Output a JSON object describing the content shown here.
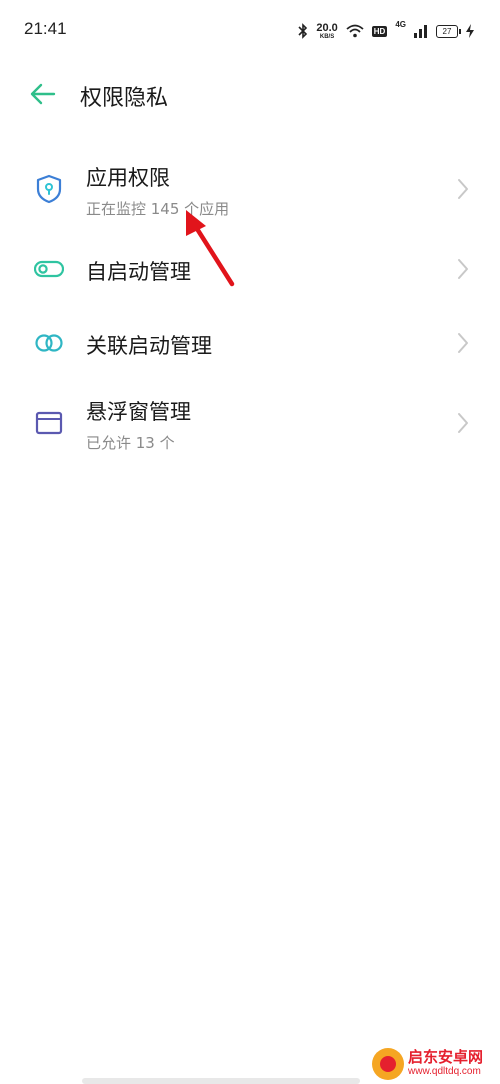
{
  "status_bar": {
    "time": "21:41",
    "net_speed_value": "20.0",
    "net_speed_unit": "KB/S",
    "hd_label": "HD",
    "signal_label": "4G",
    "battery_level": "27",
    "icons": [
      "bluetooth-icon",
      "wifi-icon",
      "signal-icon",
      "battery-icon",
      "charging-icon"
    ]
  },
  "app_bar": {
    "back_icon": "back-arrow-icon",
    "title": "权限隐私"
  },
  "settings_list": [
    {
      "icon": "shield-location-icon",
      "title": "应用权限",
      "subtitle": "正在监控 145 个应用",
      "icon_color": "#3c7fd6"
    },
    {
      "icon": "toggle-icon",
      "title": "自启动管理",
      "subtitle": "",
      "icon_color": "#2fc4a1"
    },
    {
      "icon": "linked-rings-icon",
      "title": "关联启动管理",
      "subtitle": "",
      "icon_color": "#2fb6c4"
    },
    {
      "icon": "floating-window-icon",
      "title": "悬浮窗管理",
      "subtitle": "已允许 13 个",
      "icon_color": "#5b59b0"
    }
  ],
  "colors": {
    "accent_green": "#2fbf8a",
    "chevron": "#c8c8c8",
    "annotation_red": "#e1141b"
  },
  "watermark": {
    "name": "启东安卓网",
    "url": "www.qdltdq.com"
  }
}
